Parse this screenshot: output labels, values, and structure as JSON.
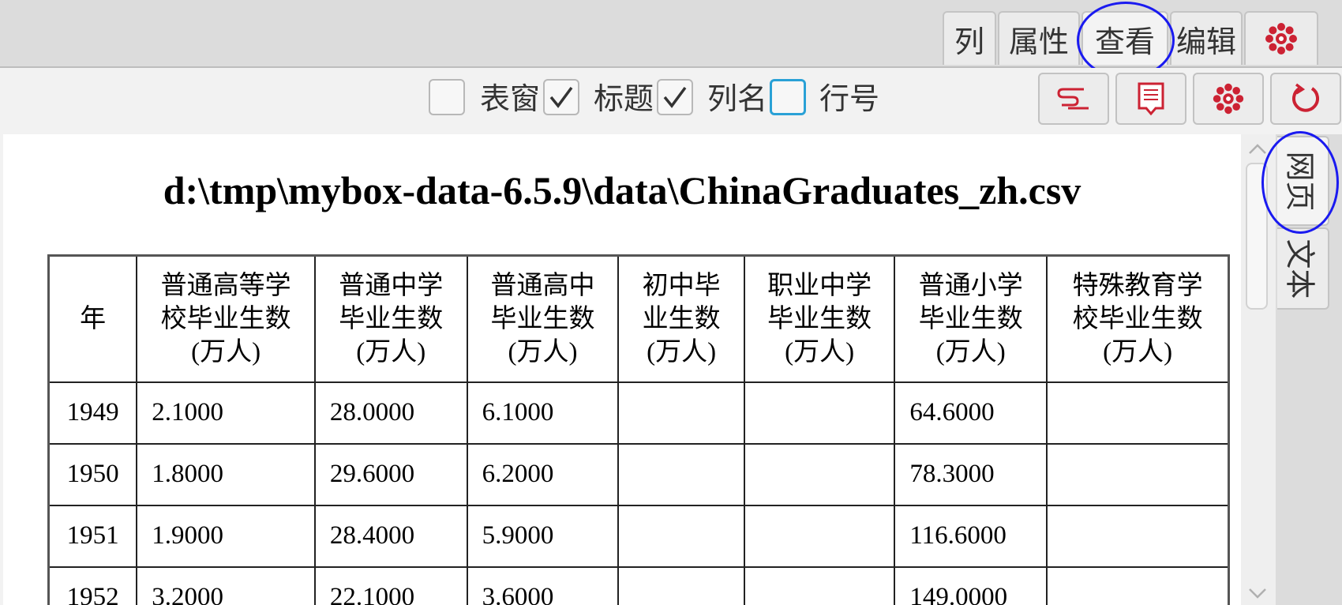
{
  "tabs": [
    {
      "label": "列"
    },
    {
      "label": "属性"
    },
    {
      "label": "查看"
    },
    {
      "label": "编辑"
    }
  ],
  "options": [
    {
      "label": "表窗",
      "checked": false
    },
    {
      "label": "标题",
      "checked": true
    },
    {
      "label": "列名",
      "checked": true
    },
    {
      "label": "行号",
      "checked": false
    }
  ],
  "side_tabs": [
    {
      "label": "网页"
    },
    {
      "label": "文本"
    }
  ],
  "accent_color": "#cc2233",
  "annotation_color": "#1a1af0",
  "page": {
    "title": "d:\\tmp\\mybox-data-6.5.9\\data\\ChinaGraduates_zh.csv"
  },
  "table": {
    "headers": [
      {
        "line1": "年",
        "line2": "",
        "line3": ""
      },
      {
        "line1": "普通高等学",
        "line2": "校毕业生数",
        "line3": "(万人)"
      },
      {
        "line1": "普通中学",
        "line2": "毕业生数",
        "line3": "(万人)"
      },
      {
        "line1": "普通高中",
        "line2": "毕业生数",
        "line3": "(万人)"
      },
      {
        "line1": "初中毕",
        "line2": "业生数",
        "line3": "(万人)"
      },
      {
        "line1": "职业中学",
        "line2": "毕业生数",
        "line3": "(万人)"
      },
      {
        "line1": "普通小学",
        "line2": "毕业生数",
        "line3": "(万人)"
      },
      {
        "line1": "特殊教育学",
        "line2": "校毕业生数",
        "line3": "(万人)"
      }
    ],
    "rows": [
      [
        "1949",
        "2.1000",
        "28.0000",
        "6.1000",
        "",
        "",
        "64.6000",
        ""
      ],
      [
        "1950",
        "1.8000",
        "29.6000",
        "6.2000",
        "",
        "",
        "78.3000",
        ""
      ],
      [
        "1951",
        "1.9000",
        "28.4000",
        "5.9000",
        "",
        "",
        "116.6000",
        ""
      ],
      [
        "1952",
        "3.2000",
        "22.1000",
        "3.6000",
        "",
        "",
        "149.0000",
        ""
      ]
    ]
  }
}
